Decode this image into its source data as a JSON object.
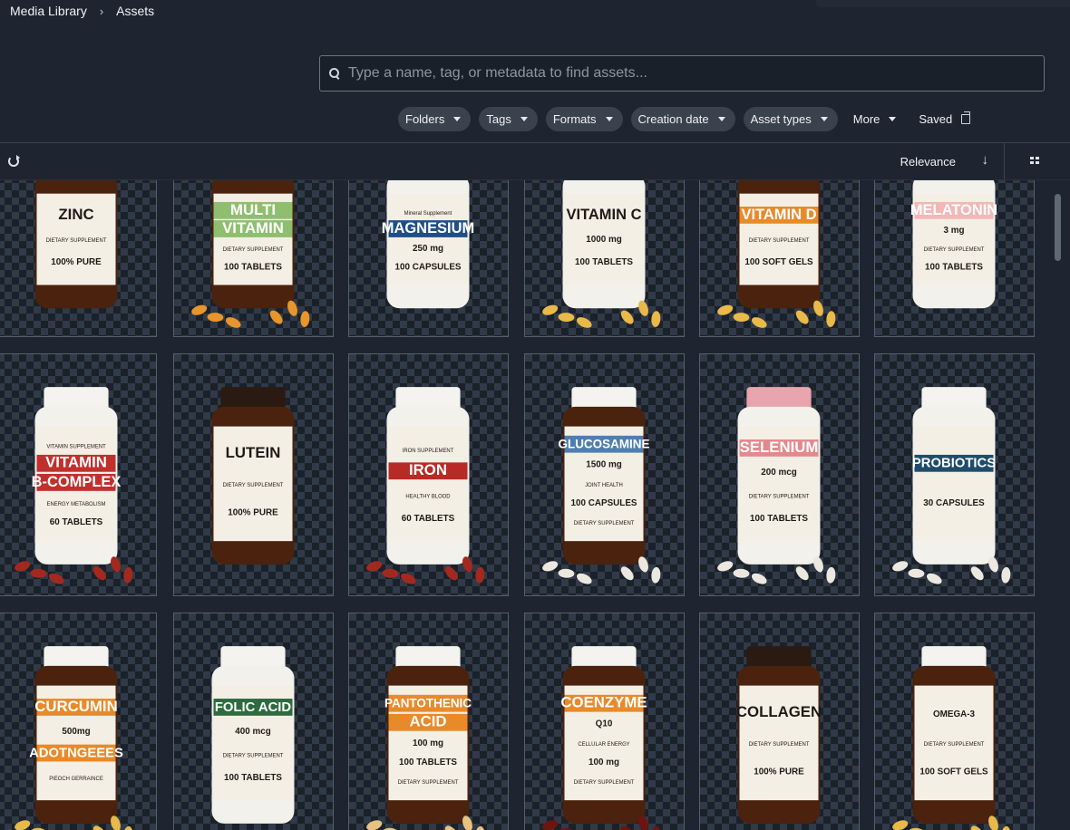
{
  "breadcrumb": {
    "root": "Media Library",
    "separator": "›",
    "current": "Assets"
  },
  "search": {
    "placeholder": "Type a name, tag, or metadata to find assets...",
    "value": "",
    "icon": "search-icon"
  },
  "filters": [
    {
      "label": "Folders",
      "dropdown": true
    },
    {
      "label": "Tags",
      "dropdown": true
    },
    {
      "label": "Formats",
      "dropdown": true
    },
    {
      "label": "Creation date",
      "dropdown": true
    },
    {
      "label": "Asset types",
      "dropdown": true
    },
    {
      "label": "More",
      "dropdown": true,
      "plain": true
    },
    {
      "label": "Saved",
      "dropdown": false,
      "plain": true,
      "icon": "saved-searches-icon"
    }
  ],
  "toolbar": {
    "sort_label": "Relevance",
    "sort_direction_icon": "arrow-down-icon",
    "refresh_icon": "refresh-icon",
    "view_icon": "grid-view-icon"
  },
  "assets": [
    {
      "lines": [
        "ZINC",
        "DIETARY SUPPLEMENT",
        "100% PURE"
      ],
      "bottle": "amber",
      "cap": "none",
      "band": "",
      "pills": "none"
    },
    {
      "lines": [
        "MULTI",
        "VITAMIN",
        "DIETARY SUPPLEMENT",
        "100 TABLETS"
      ],
      "bottle": "amber",
      "cap": "none",
      "band": "#8fbf6e",
      "pills": "orange"
    },
    {
      "lines": [
        "Mineral Supplement",
        "MAGNESIUM",
        "250 mg",
        "100 CAPSULES"
      ],
      "bottle": "white",
      "cap": "none",
      "band": "#1f4f86",
      "pills": "none"
    },
    {
      "lines": [
        "VITAMIN C",
        "1000 mg",
        "100 TABLETS"
      ],
      "bottle": "white",
      "cap": "none",
      "band": "",
      "pills": "yellow"
    },
    {
      "lines": [
        "VITAMIN D",
        "DIETARY SUPPLEMENT",
        "100 SOFT GELS"
      ],
      "bottle": "amber",
      "cap": "none",
      "band": "#e88a2a",
      "pills": "yellow"
    },
    {
      "lines": [
        "MELATONIN",
        "3 mg",
        "DIETARY SUPPLEMENT",
        "100 TABLETS"
      ],
      "bottle": "white",
      "cap": "none",
      "band": "#f2b7b7",
      "pills": "none"
    },
    {
      "lines": [
        "VITAMIN SUPPLEMENT",
        "VITAMIN",
        "B-COMPLEX",
        "ENERGY METABOLISM",
        "60 TABLETS"
      ],
      "bottle": "white",
      "cap": "white",
      "band": "#c0302d",
      "pills": "red"
    },
    {
      "lines": [
        "LUTEIN",
        "DIETARY SUPPLEMENT",
        "100% PURE"
      ],
      "bottle": "amber",
      "cap": "dark",
      "band": "",
      "pills": "none"
    },
    {
      "lines": [
        "IRON SUPPLEMENT",
        "IRON",
        "HEALTHY BLOOD",
        "60 TABLETS"
      ],
      "bottle": "white",
      "cap": "white",
      "band": "#b82b25",
      "pills": "red"
    },
    {
      "lines": [
        "GLUCOSAMINE",
        "1500 mg",
        "JOINT HEALTH",
        "100 CAPSULES",
        "DIETARY SUPPLEMENT"
      ],
      "bottle": "amber",
      "cap": "white",
      "band": "#4f7fae",
      "pills": "white"
    },
    {
      "lines": [
        "SELENIUM",
        "200 mcg",
        "DIETARY SUPPLEMENT",
        "100 TABLETS"
      ],
      "bottle": "white",
      "cap": "pink",
      "band": "#e3898d",
      "pills": "white"
    },
    {
      "lines": [
        "PROBIOTICS",
        "30 CAPSULES"
      ],
      "bottle": "white",
      "cap": "white",
      "band": "#1e4d6b",
      "pills": "white"
    },
    {
      "lines": [
        "CURCUMIN",
        "500mg",
        "ADOTNGEEES",
        "PIEOCH GERRAINCE"
      ],
      "bottle": "amber",
      "cap": "white",
      "band": "#e88a2a",
      "pills": "yellow"
    },
    {
      "lines": [
        "FOLIC ACID",
        "400 mcg",
        "DIETARY SUPPLEMENT",
        "100 TABLETS"
      ],
      "bottle": "white",
      "cap": "white",
      "band": "#2e6b3f",
      "pills": "none"
    },
    {
      "lines": [
        "PANTOTHENIC",
        "ACID",
        "100 mg",
        "100 TABLETS",
        "DIETARY SUPPLEMENT"
      ],
      "bottle": "amber",
      "cap": "white",
      "band": "#e88a2a",
      "pills": "cream"
    },
    {
      "lines": [
        "COENZYME",
        "Q10",
        "CELLULAR ENERGY",
        "100 mg",
        "DIETARY SUPPLEMENT"
      ],
      "bottle": "amber",
      "cap": "white",
      "band": "#e88a2a",
      "pills": "darkred"
    },
    {
      "lines": [
        "COLLAGEN",
        "DIETARY SUPPLEMENT",
        "100% PURE"
      ],
      "bottle": "amber",
      "cap": "dark",
      "band": "",
      "pills": "none"
    },
    {
      "lines": [
        "OMEGA-3",
        "DIETARY SUPPLEMENT",
        "100 SOFT GELS"
      ],
      "bottle": "amber",
      "cap": "white",
      "band": "#4f7fae",
      "pills": "yellow"
    }
  ],
  "colors": {
    "background": "#1e2530",
    "chip": "#3a424e",
    "card_border": "#55606e",
    "accent_text": "#e6e9ee"
  }
}
